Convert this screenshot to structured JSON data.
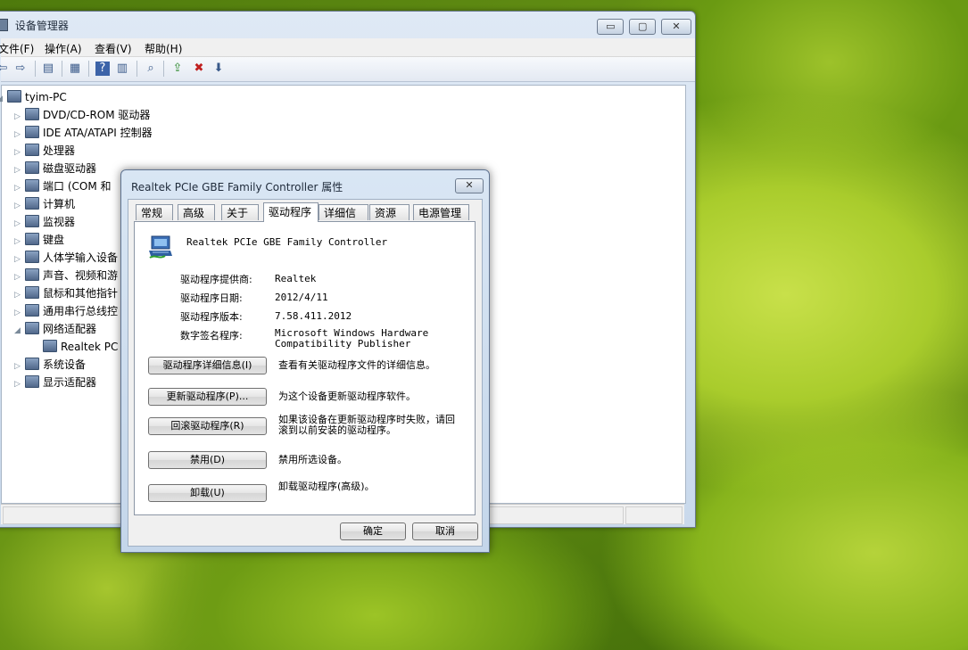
{
  "device_manager": {
    "title": "设备管理器",
    "caption": {
      "minimize": "▭",
      "maximize": "▢",
      "close": "✕"
    },
    "menu": [
      "文件(F)",
      "操作(A)",
      "查看(V)",
      "帮助(H)"
    ],
    "tree": {
      "root": "tyim-PC",
      "items": [
        {
          "label": "DVD/CD-ROM 驱动器",
          "expander": "▷"
        },
        {
          "label": "IDE ATA/ATAPI 控制器",
          "expander": "▷"
        },
        {
          "label": "处理器",
          "expander": "▷"
        },
        {
          "label": "磁盘驱动器",
          "expander": "▷"
        },
        {
          "label": "端口 (COM 和",
          "expander": "▷"
        },
        {
          "label": "计算机",
          "expander": "▷"
        },
        {
          "label": "监视器",
          "expander": "▷"
        },
        {
          "label": "键盘",
          "expander": "▷"
        },
        {
          "label": "人体学输入设备",
          "expander": "▷"
        },
        {
          "label": "声音、视频和游",
          "expander": "▷"
        },
        {
          "label": "鼠标和其他指针",
          "expander": "▷"
        },
        {
          "label": "通用串行总线控",
          "expander": "▷"
        },
        {
          "label": "网络适配器",
          "expander": "◢"
        },
        {
          "label": "Realtek PC",
          "expander": ""
        },
        {
          "label": "系统设备",
          "expander": "▷"
        },
        {
          "label": "显示适配器",
          "expander": "▷"
        }
      ]
    }
  },
  "dialog": {
    "title": "Realtek PCIe GBE Family Controller 属性",
    "close_glyph": "✕",
    "tabs": [
      "常规",
      "高级",
      "关于",
      "驱动程序",
      "详细信息",
      "资源",
      "电源管理"
    ],
    "active_tab": "驱动程序",
    "device_name": "Realtek PCIe GBE Family Controller",
    "fields": [
      {
        "label": "驱动程序提供商:",
        "value": "Realtek"
      },
      {
        "label": "驱动程序日期:",
        "value": "2012/4/11"
      },
      {
        "label": "驱动程序版本:",
        "value": "7.58.411.2012"
      },
      {
        "label": "数字签名程序:",
        "value": "Microsoft Windows Hardware Compatibility Publisher"
      }
    ],
    "actions": [
      {
        "button": "驱动程序详细信息(I)",
        "description": "查看有关驱动程序文件的详细信息。"
      },
      {
        "button": "更新驱动程序(P)...",
        "description": "为这个设备更新驱动程序软件。"
      },
      {
        "button": "回滚驱动程序(R)",
        "description": "如果该设备在更新驱动程序时失败，请回滚到以前安装的驱动程序。"
      },
      {
        "button": "禁用(D)",
        "description": "禁用所选设备。"
      },
      {
        "button": "卸载(U)",
        "description": "卸载驱动程序(高级)。"
      }
    ],
    "ok": "确定",
    "cancel": "取消"
  }
}
